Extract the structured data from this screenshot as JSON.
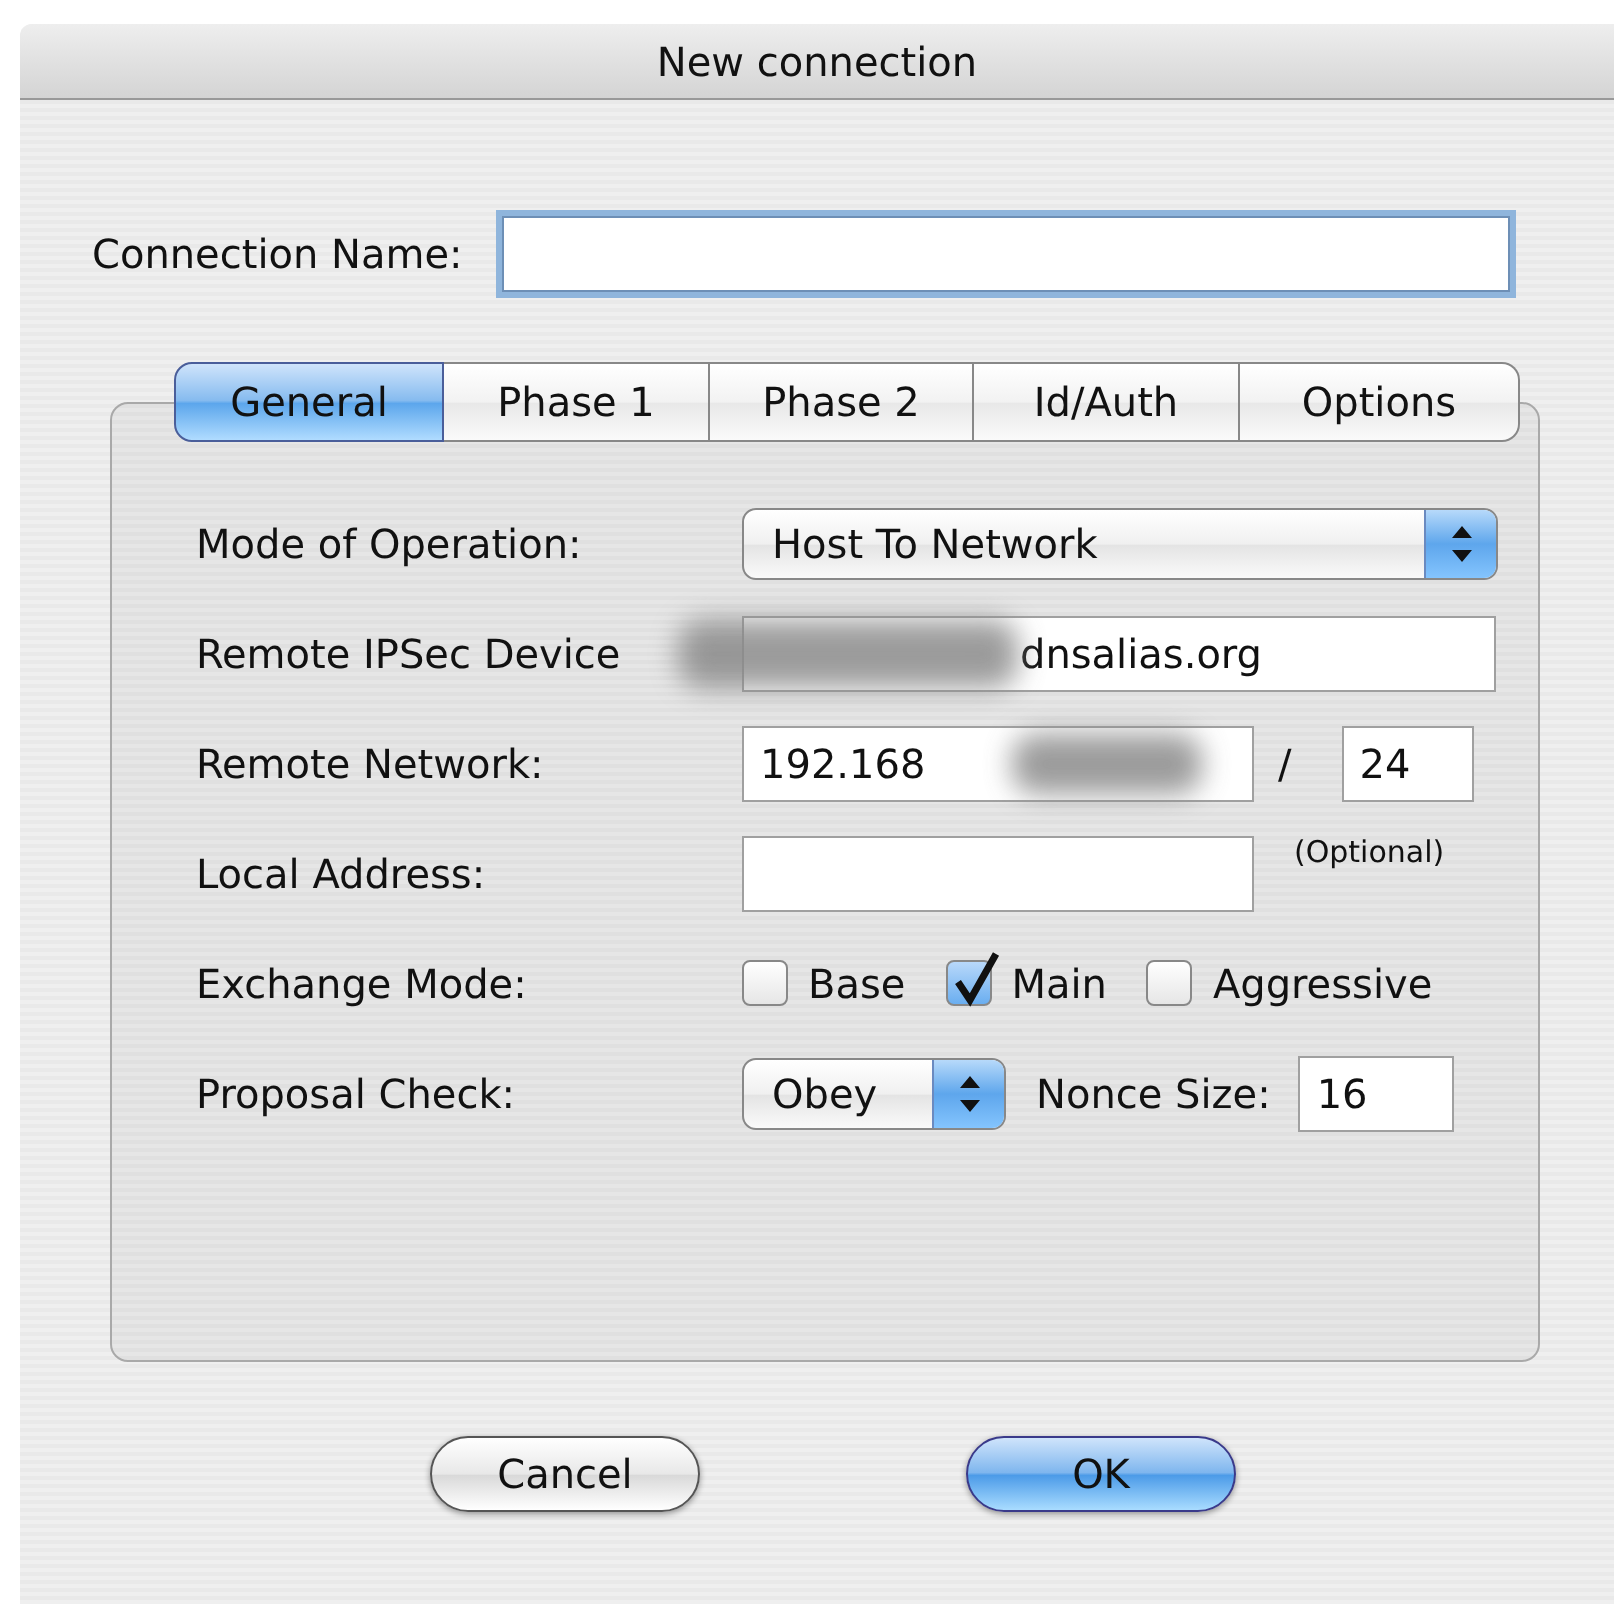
{
  "window": {
    "title": "New connection"
  },
  "connection_name": {
    "label": "Connection Name:",
    "focused": true
  },
  "tabs": [
    {
      "label": "General",
      "selected": true
    },
    {
      "label": "Phase 1",
      "selected": false
    },
    {
      "label": "Phase 2",
      "selected": false
    },
    {
      "label": "Id/Auth",
      "selected": false
    },
    {
      "label": "Options",
      "selected": false
    }
  ],
  "rows": [
    {
      "kind": "popup",
      "label": "Mode of Operation:",
      "value": "Host To Network"
    },
    {
      "kind": "text",
      "label": "Remote IPSec Device",
      "value": "dnsalias.org",
      "redacted": true
    },
    {
      "kind": "network",
      "label": "Remote Network:",
      "value": "192.168",
      "separator": "/",
      "prefix": "24",
      "redacted": true
    },
    {
      "kind": "text",
      "label": "Local Address:",
      "note": "(Optional)",
      "redacted": false
    },
    {
      "kind": "checks",
      "label": "Exchange Mode:",
      "options": [
        {
          "label": "Base",
          "checked": false
        },
        {
          "label": "Main",
          "checked": true
        },
        {
          "label": "Aggressive",
          "checked": false
        }
      ]
    },
    {
      "kind": "proposal",
      "label": "Proposal Check:",
      "value": "Obey",
      "extra_label": "Nonce Size:",
      "extra_value": "16"
    }
  ],
  "buttons": [
    {
      "label": "Cancel",
      "default": false
    },
    {
      "label": "OK",
      "default": true
    }
  ]
}
